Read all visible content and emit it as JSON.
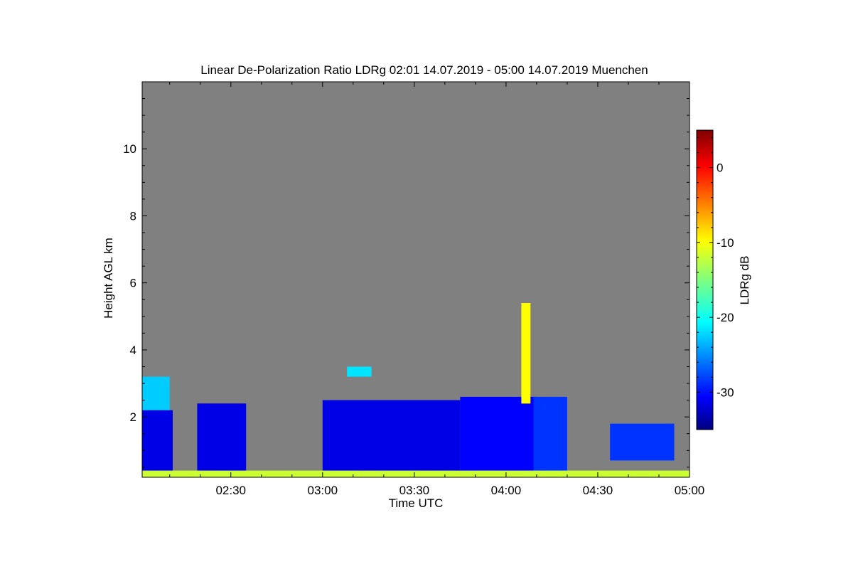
{
  "chart_data": {
    "type": "heatmap",
    "title": "Linear De-Polarization Ratio LDRg   02:01 14.07.2019 - 05:00 14.07.2019 Muenchen",
    "xlabel": "Time UTC",
    "ylabel": "Height AGL km",
    "colorbar_label": "LDRg dB",
    "x_range": [
      "02:01",
      "05:00"
    ],
    "x_tick_labels": [
      "02:30",
      "03:00",
      "03:30",
      "04:00",
      "04:30",
      "05:00"
    ],
    "ylim": [
      0.2,
      12.0
    ],
    "y_tick_labels": [
      "2",
      "4",
      "6",
      "8",
      "10"
    ],
    "colorbar_range": [
      -35,
      5
    ],
    "colorbar_tick_labels": [
      "0",
      "-10",
      "-20",
      "-30"
    ],
    "colormap": "jet",
    "background_color": "#808080",
    "features": [
      {
        "time_start": "02:01",
        "time_end": "02:10",
        "height_bottom": 2.1,
        "height_top": 3.2,
        "ldr_db": -22
      },
      {
        "time_start": "02:01",
        "time_end": "02:11",
        "height_bottom": 0.2,
        "height_top": 2.2,
        "ldr_db": -31
      },
      {
        "time_start": "02:19",
        "time_end": "02:35",
        "height_bottom": 0.2,
        "height_top": 2.4,
        "ldr_db": -31
      },
      {
        "time_start": "03:00",
        "time_end": "03:45",
        "height_bottom": 0.2,
        "height_top": 2.5,
        "ldr_db": -31
      },
      {
        "time_start": "03:45",
        "time_end": "04:10",
        "height_bottom": 0.2,
        "height_top": 2.6,
        "ldr_db": -30
      },
      {
        "time_start": "04:05",
        "time_end": "04:08",
        "height_bottom": 2.4,
        "height_top": 5.4,
        "ldr_db": -10
      },
      {
        "time_start": "04:09",
        "time_end": "04:20",
        "height_bottom": 0.3,
        "height_top": 2.6,
        "ldr_db": -28
      },
      {
        "time_start": "03:08",
        "time_end": "03:16",
        "height_bottom": 3.2,
        "height_top": 3.5,
        "ldr_db": -21
      },
      {
        "time_start": "04:34",
        "time_end": "04:55",
        "height_bottom": 0.7,
        "height_top": 1.8,
        "ldr_db": -28
      },
      {
        "time_start": "02:01",
        "time_end": "05:00",
        "height_bottom": 0.2,
        "height_top": 0.4,
        "ldr_db": -12
      }
    ]
  }
}
